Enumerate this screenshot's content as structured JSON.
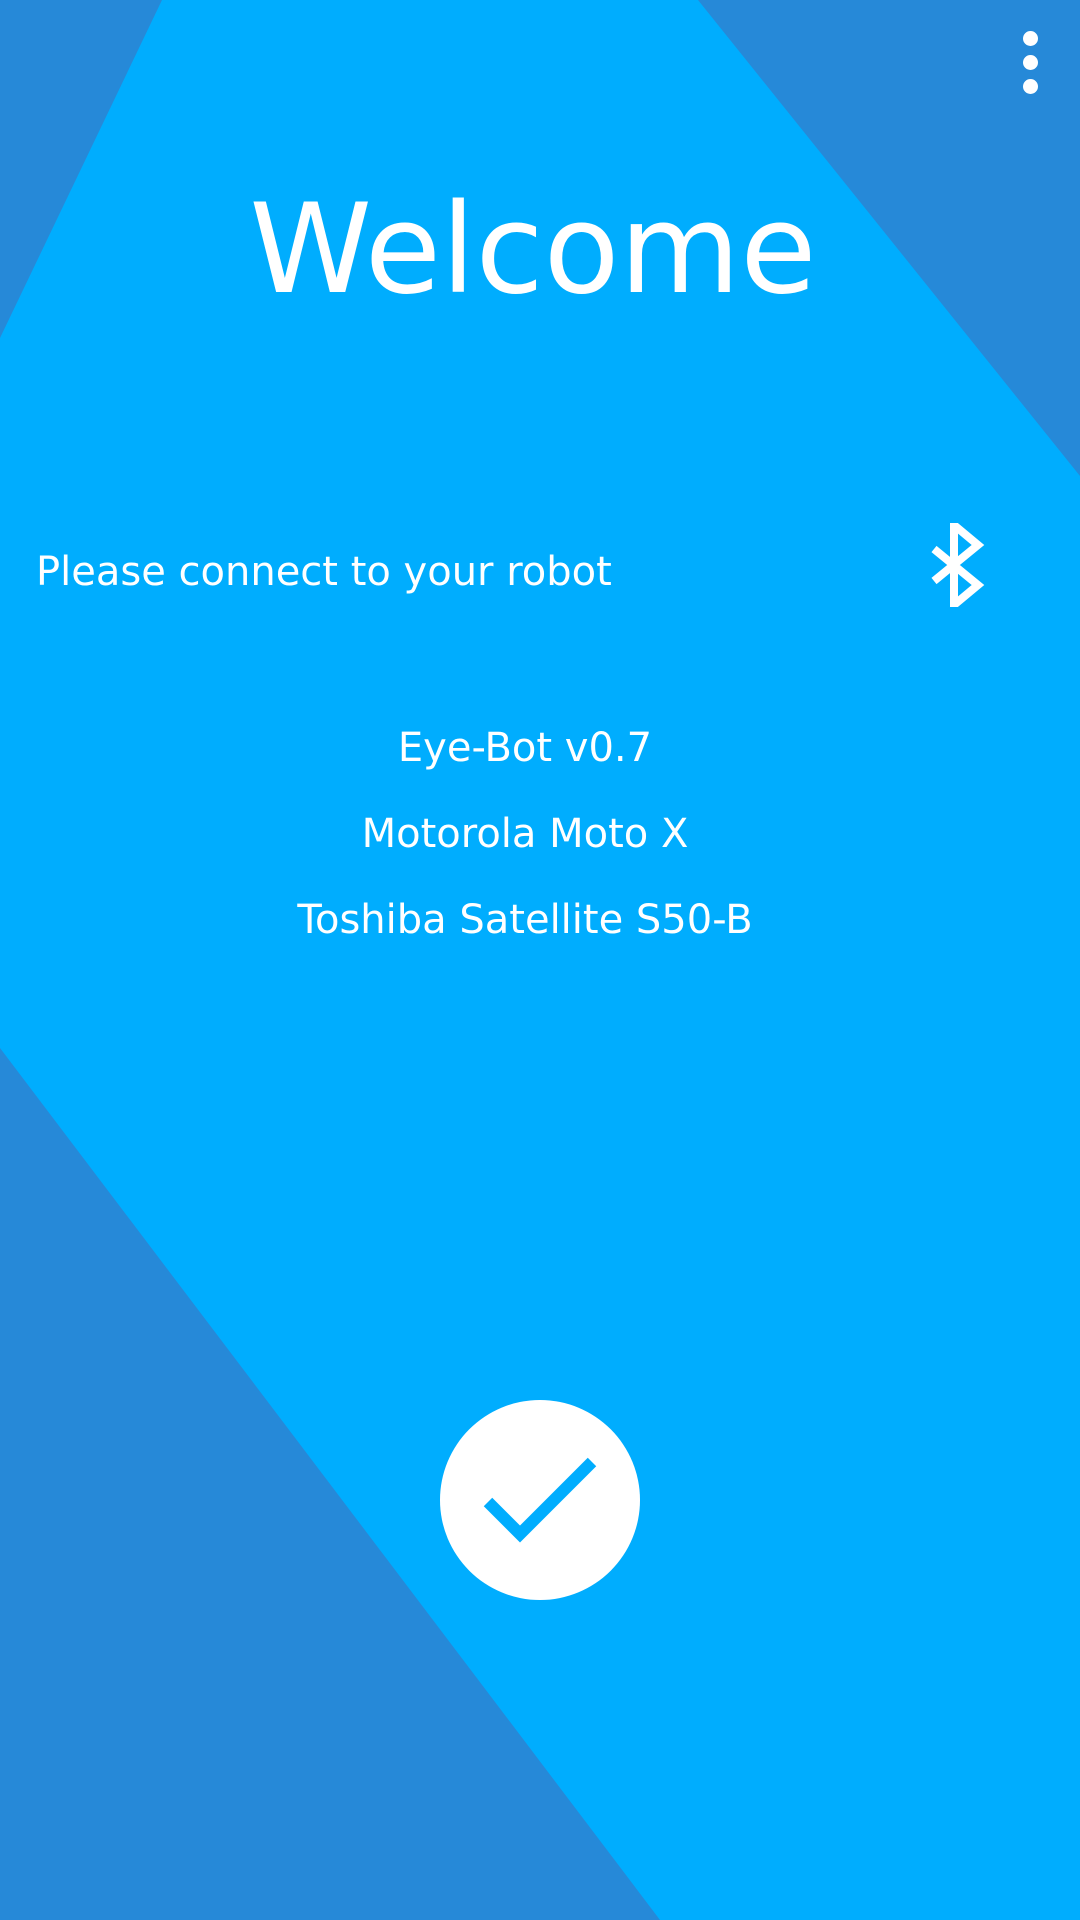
{
  "screen": {
    "title": "Welcome",
    "prompt": "Please connect to your robot"
  },
  "colors": {
    "primary": "#00ADFE",
    "dark_band": "#2689D8",
    "on_primary": "#FFFFFF"
  },
  "icons": {
    "menu": "more-vertical-icon",
    "bluetooth": "bluetooth-icon",
    "confirm": "checkmark-icon"
  },
  "devices": [
    {
      "name": "Eye-Bot v0.7"
    },
    {
      "name": "Motorola Moto X"
    },
    {
      "name": "Toshiba Satellite S50-B"
    }
  ]
}
